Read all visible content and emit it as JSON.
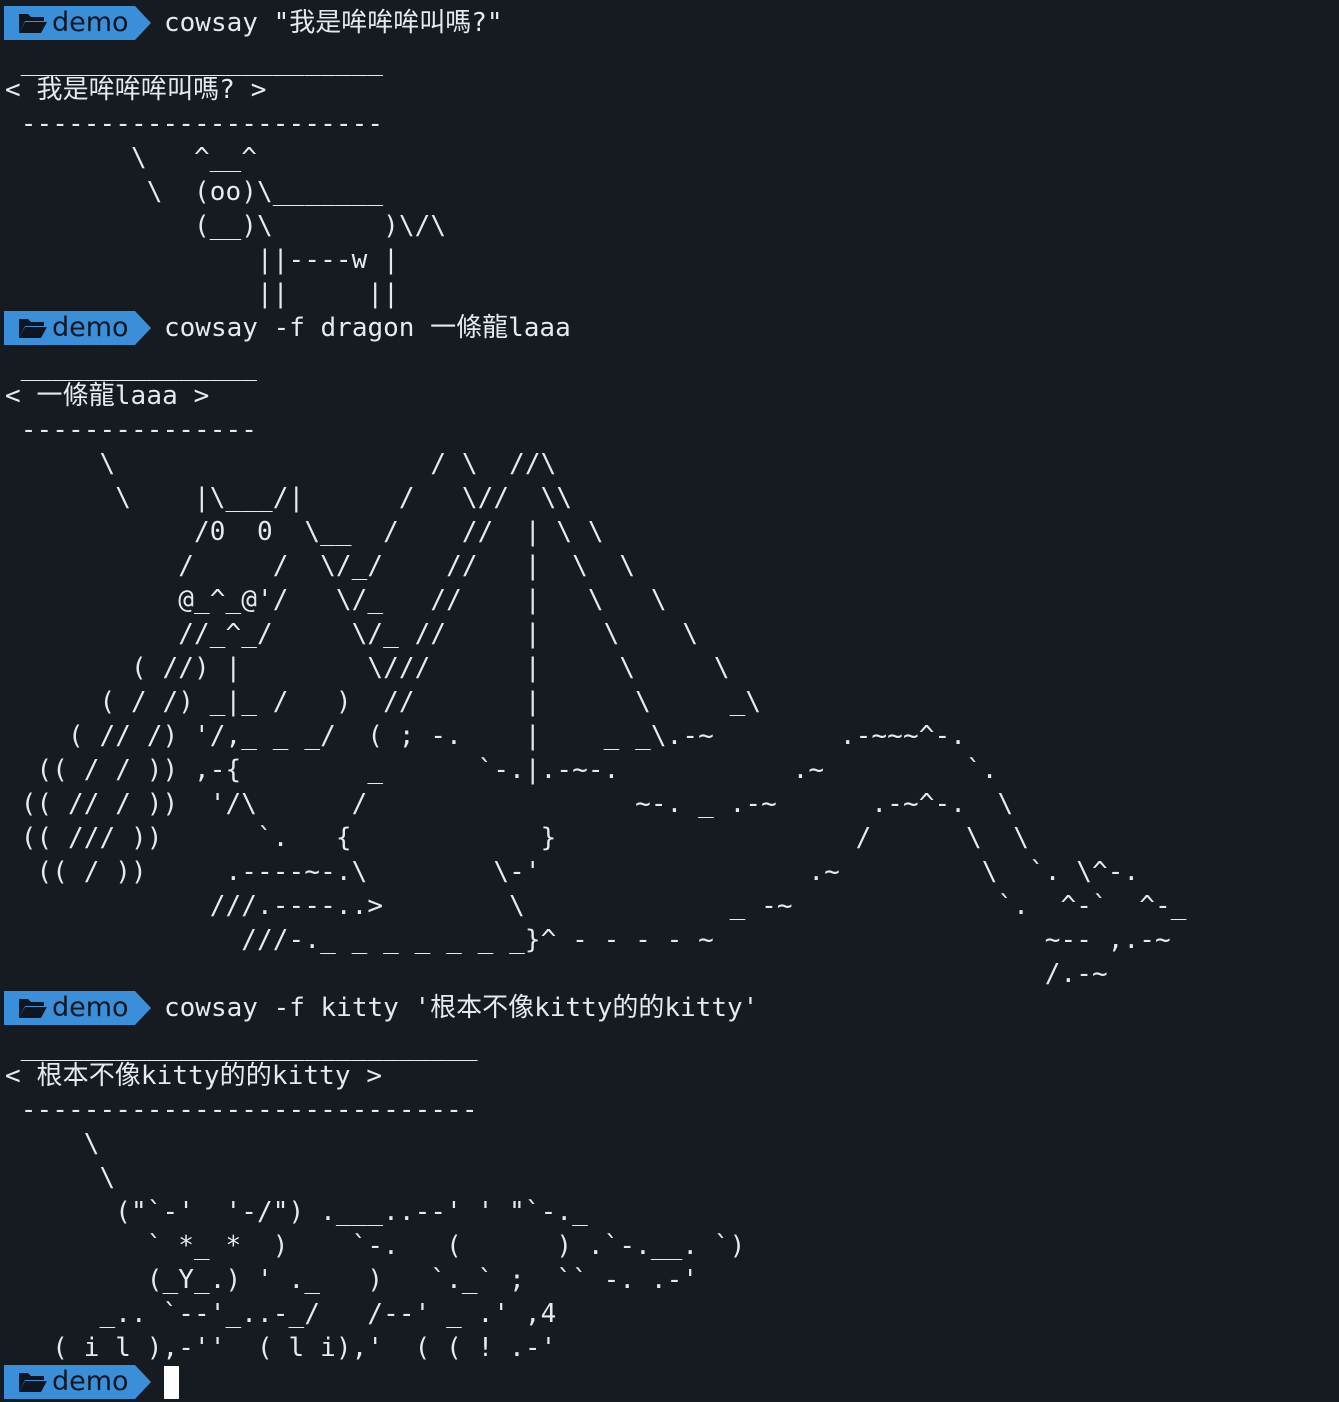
{
  "terminal": {
    "prompt_label": "demo",
    "prompt_color": "#3b8fd9",
    "background": "#161b22",
    "blocks": [
      {
        "command": "cowsay \"我是哞哞哞叫嗎?\"",
        "output": [
          " _______________________",
          "< 我是哞哞哞叫嗎? >",
          " -----------------------",
          "        \\   ^__^",
          "         \\  (oo)\\_______",
          "            (__)\\       )\\/\\",
          "                ||----w |",
          "                ||     ||"
        ]
      },
      {
        "command": "cowsay -f dragon 一條龍laaa",
        "output": [
          " _______________",
          "< 一條龍laaa >",
          " ---------------",
          "      \\                    / \\  //\\",
          "       \\    |\\___/|      /   \\//  \\\\",
          "            /0  0  \\__  /    //  | \\ \\",
          "           /     /  \\/_/    //   |  \\  \\",
          "           @_^_@'/   \\/_   //    |   \\   \\",
          "           //_^_/     \\/_ //     |    \\    \\",
          "        ( //) |        \\///      |     \\     \\",
          "      ( / /) _|_ /   )  //       |      \\     _\\",
          "    ( // /) '/,_ _ _/  ( ; -.    |    _ _\\.-~        .-~~~^-.",
          "  (( / / )) ,-{        _      `-.|.-~-.           .~         `.",
          " (( // / ))  '/\\      /                 ~-. _ .-~      .-~^-.  \\",
          " (( /// ))      `.   {            }                   /      \\  \\",
          "  (( / ))     .----~-.\\        \\-'                 .~         \\  `. \\^-.",
          "             ///.----..>        \\             _ -~             `.  ^-`  ^-_",
          "               ///-._ _ _ _ _ _ _}^ - - - - ~                     ~-- ,.-~",
          "                                                                  /.-~"
        ]
      },
      {
        "command": "cowsay -f kitty '根本不像kitty的的kitty'",
        "output": [
          " _____________________________",
          "< 根本不像kitty的的kitty >",
          " -----------------------------",
          "     \\",
          "      \\",
          "       (\"`-'  '-/\") .___..--' ' \"`-._",
          "         ` *_ *  )    `-.   (      ) .`-.__. `)",
          "         (_Y_.) ' ._   )   `._` ;  `` -. .-'",
          "      _.. `--'_..-_/   /--' _ .' ,4",
          "   ( i l ),-''  ( l i),'  ( ( ! .-'"
        ]
      }
    ]
  }
}
